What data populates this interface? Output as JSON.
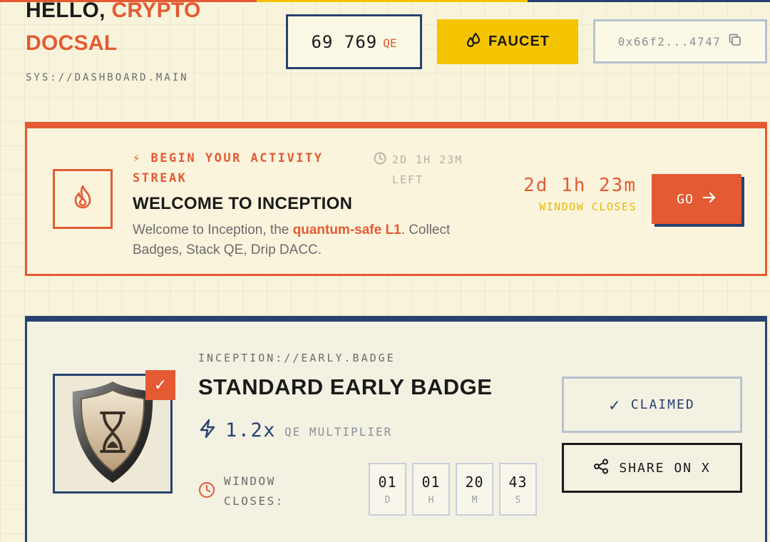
{
  "header": {
    "greeting_prefix": "HELLO, ",
    "greeting_name": "CRYPTO DOCSAL",
    "sys_path": "SYS://DASHBOARD.MAIN",
    "balance_value": "69 769",
    "balance_unit": "QE",
    "faucet_label": "FAUCET",
    "wallet_address": "0x66f2...4747"
  },
  "streak": {
    "kicker": "⚡ BEGIN YOUR ACTIVITY STREAK",
    "time_left": "2D 1H 23M LEFT",
    "title": "WELCOME TO INCEPTION",
    "desc_prefix": "Welcome to Inception, the ",
    "desc_highlight": "quantum-safe L1",
    "desc_suffix": ". Collect Badges, Stack QE, Drip DACC.",
    "countdown": "2d 1h 23m",
    "countdown_label": "WINDOW CLOSES",
    "go_label": "GO",
    "accent_color": "#e45a32"
  },
  "badge": {
    "path": "INCEPTION://EARLY.BADGE",
    "title": "STANDARD EARLY BADGE",
    "multiplier_value": "1.2x",
    "multiplier_label": "QE MULTIPLIER",
    "window_label": "WINDOW CLOSES:",
    "countdown": [
      {
        "value": "01",
        "unit": "D"
      },
      {
        "value": "01",
        "unit": "H"
      },
      {
        "value": "20",
        "unit": "M"
      },
      {
        "value": "43",
        "unit": "S"
      }
    ],
    "claimed_label": "CLAIMED",
    "share_label": "SHARE ON X",
    "accent_color": "#27426e"
  },
  "icons": {
    "faucet": "droplets-icon",
    "wallet_copy": "copy-icon",
    "streak": "flame-icon",
    "clock": "clock-icon",
    "go": "arrow-right-icon",
    "multiplier": "lightning-icon",
    "badge": "shield-hourglass-icon",
    "share": "share-icon",
    "claimed": "check-icon"
  }
}
